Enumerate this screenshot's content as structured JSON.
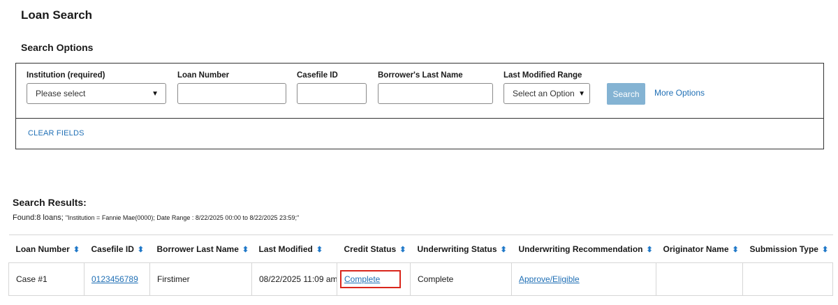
{
  "page": {
    "title": "Loan Search"
  },
  "search": {
    "section_title": "Search Options",
    "institution": {
      "label": "Institution (required)",
      "value": "Please select"
    },
    "loan_number": {
      "label": "Loan Number",
      "value": "",
      "placeholder": ""
    },
    "casefile_id": {
      "label": "Casefile ID",
      "value": "",
      "placeholder": ""
    },
    "borrower_last_name": {
      "label": "Borrower's Last Name",
      "value": "",
      "placeholder": ""
    },
    "last_modified_range": {
      "label": "Last Modified Range",
      "value": "Select an Option"
    },
    "search_label": "Search",
    "more_options_label": "More Options",
    "clear_fields_label": "CLEAR FIELDS"
  },
  "results": {
    "title": "Search Results:",
    "found": "Found:8 loans;",
    "detail": "\"Institution = Fannie Mae(0000); Date Range : 8/22/2025 00:00 to 8/22/2025 23:59;\"",
    "columns": [
      "Loan Number",
      "Casefile ID",
      "Borrower Last Name",
      "Last Modified",
      "Credit Status",
      "Underwriting Status",
      "Underwriting Recommendation",
      "Originator Name",
      "Submission Type"
    ],
    "rows": [
      {
        "loan_number": "Case #1",
        "casefile_id": "0123456789",
        "borrower_last_name": "Firstimer",
        "last_modified": "08/22/2025 11:09 am",
        "credit_status": "Complete",
        "underwriting_status": "Complete",
        "underwriting_recommendation": "Approve/Eligible",
        "originator_name": "",
        "submission_type": ""
      }
    ]
  },
  "colors": {
    "link": "#1f6fb5",
    "search_button": "#84b3d3",
    "highlight": "#d9261c",
    "sort_icon": "#1f78c8"
  },
  "icons": {
    "dropdown": "caret-down-icon",
    "sort": "sort-arrows-icon"
  }
}
